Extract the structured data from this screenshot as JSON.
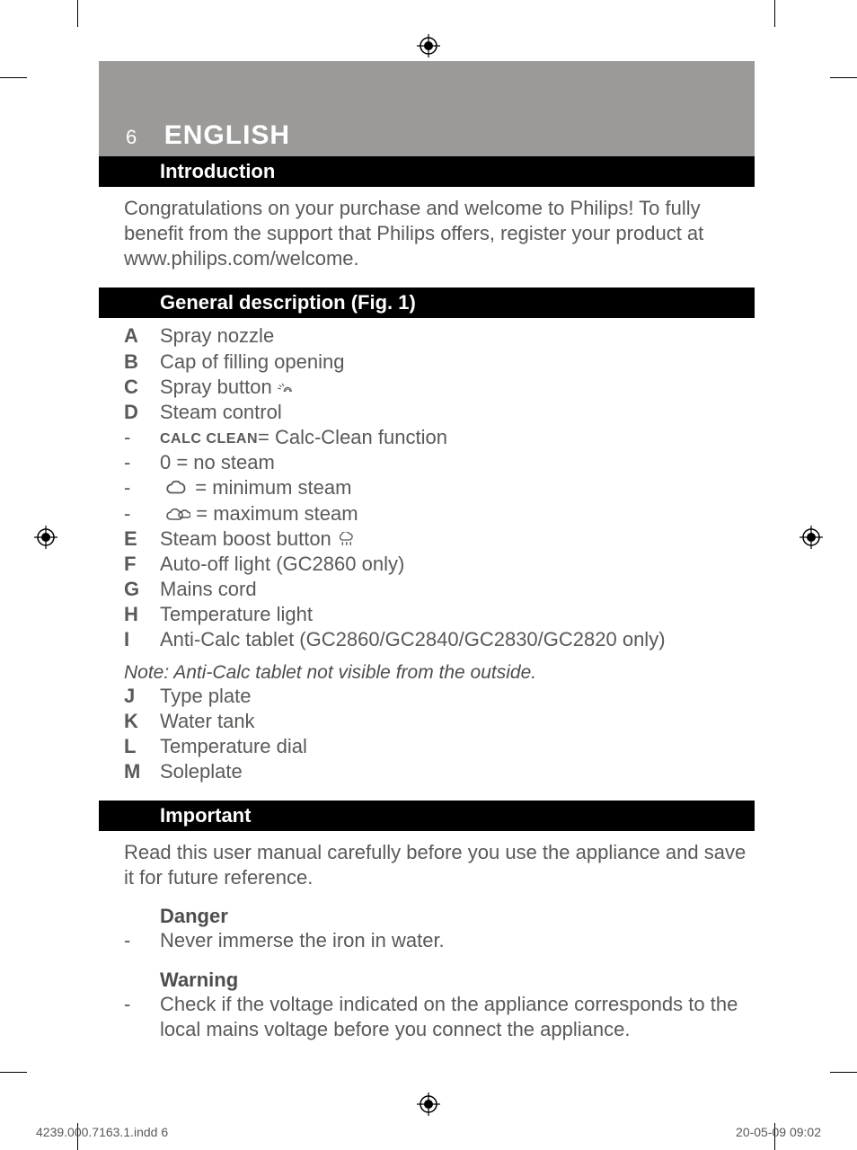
{
  "header": {
    "page_number": "6",
    "title": "ENGLISH"
  },
  "sections": {
    "intro": {
      "heading": "Introduction",
      "body": "Congratulations on your purchase and welcome to Philips! To fully benefit from the support that Philips offers, register your product at www.philips.com/welcome."
    },
    "general": {
      "heading": "General description (Fig. 1)",
      "items": {
        "a": {
          "label": "A",
          "text": "Spray nozzle"
        },
        "b": {
          "label": "B",
          "text": "Cap of filling opening"
        },
        "c": {
          "label": "C",
          "text": "Spray button "
        },
        "d": {
          "label": "D",
          "text": "Steam control"
        },
        "calc": {
          "label_smallcaps": "CALC CLEAN",
          "text": "= Calc-Clean function"
        },
        "zero": {
          "text": " 0 = no steam"
        },
        "min": {
          "text_after": " = minimum steam"
        },
        "max": {
          "text_after": " = maximum steam"
        },
        "e": {
          "label": "E",
          "text": "Steam boost button "
        },
        "f": {
          "label": "F",
          "text": "Auto-off light (GC2860 only)"
        },
        "g": {
          "label": "G",
          "text": "Mains cord"
        },
        "h": {
          "label": "H",
          "text": "Temperature light"
        },
        "i": {
          "label": "I",
          "text": "Anti-Calc tablet (GC2860/GC2840/GC2830/GC2820 only)"
        }
      },
      "note": "Note: Anti-Calc tablet not visible from the outside.",
      "items2": {
        "j": {
          "label": "J",
          "text": "Type plate"
        },
        "k": {
          "label": "K",
          "text": "Water tank"
        },
        "l": {
          "label": "L",
          "text": "Temperature dial"
        },
        "m": {
          "label": "M",
          "text": "Soleplate"
        }
      }
    },
    "important": {
      "heading": "Important",
      "body": "Read this user manual carefully before you use the appliance and save it for future reference.",
      "danger_heading": "Danger",
      "danger_item": "Never immerse the iron in water.",
      "warning_heading": "Warning",
      "warning_item": "Check if the voltage indicated on the appliance corresponds to the local mains voltage before you connect the appliance."
    }
  },
  "footer": {
    "left": "4239.000.7163.1.indd   6",
    "right": "20-05-09   09:02"
  }
}
